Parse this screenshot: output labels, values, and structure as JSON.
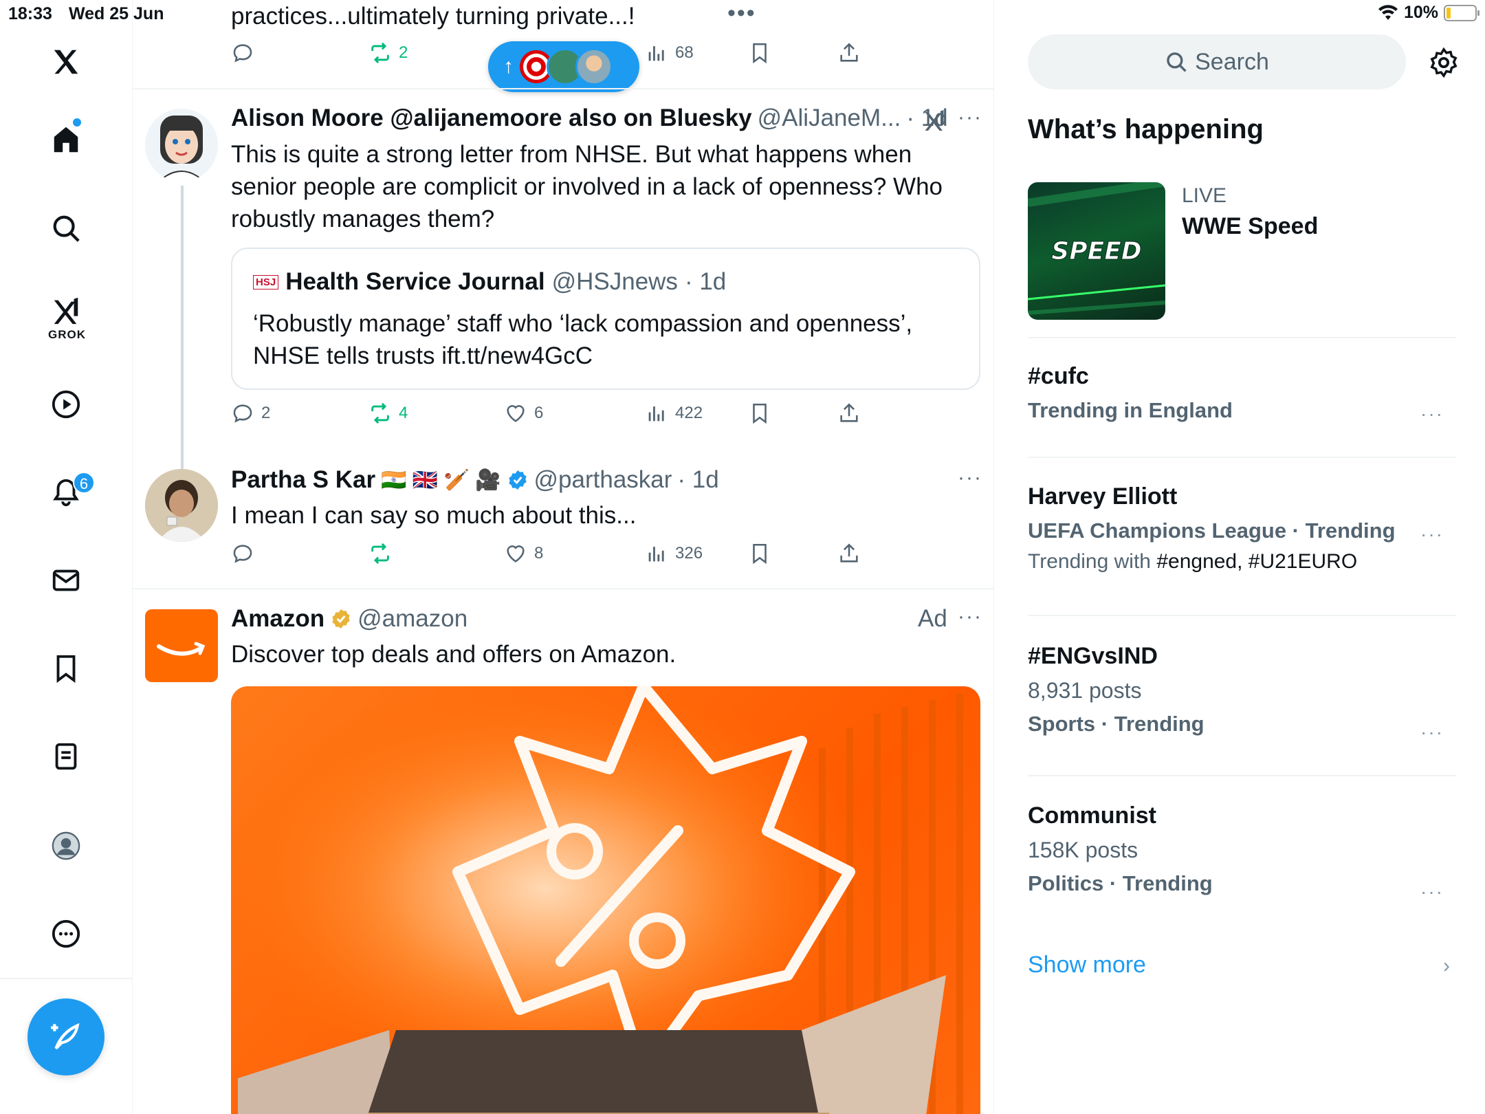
{
  "status": {
    "time": "18:33",
    "date": "Wed 25 Jun",
    "battery": "10%"
  },
  "nav": {
    "grok_label": "GROK",
    "notifications_count": "6"
  },
  "new_posts_pill": {
    "arrow": "↑"
  },
  "top_tweet": {
    "text": "practices...ultimately turning private...!",
    "retweets": "2",
    "views": "68"
  },
  "tweets": [
    {
      "name": "Alison Moore @alijanemoore also on Bluesky",
      "handle": "@AliJaneM...",
      "time": "· 1d",
      "text": "This is quite a strong letter from NHSE. But what happens when senior people are complicit or involved in a lack of openness? Who robustly manages them?",
      "quote": {
        "badge": "HSJ",
        "name": "Health Service Journal",
        "handle": "@HSJnews",
        "time": "· 1d",
        "text": "‘Robustly manage’ staff who ‘lack compassion and openness’, NHSE tells trusts ift.tt/new4GcC"
      },
      "replies": "2",
      "retweets": "4",
      "likes": "6",
      "views": "422"
    },
    {
      "name": "Partha S Kar",
      "emojis": "🇮🇳 🇬🇧 🏏 🎥",
      "handle": "@parthaskar",
      "time": "· 1d",
      "text": "I mean I can say so much about this...",
      "likes": "8",
      "views": "326"
    },
    {
      "name": "Amazon",
      "handle": "@amazon",
      "ad_label": "Ad",
      "text": "Discover top deals and offers on Amazon."
    }
  ],
  "right": {
    "search_placeholder": "Search",
    "heading": "What’s happening",
    "live": {
      "label": "LIVE",
      "title": "WWE Speed",
      "thumb_text": "SPEED"
    },
    "trends": [
      {
        "name": "#cufc",
        "meta": "Trending in England"
      },
      {
        "name": "Harvey Elliott",
        "meta": "UEFA Champions League · Trending",
        "with_prefix": "Trending with",
        "with_tags": "#engned, #U21EURO"
      },
      {
        "name": "#ENGvsIND",
        "posts": "8,931 posts",
        "meta": "Sports · Trending"
      },
      {
        "name": "Communist",
        "posts": "158K posts",
        "meta": "Politics · Trending"
      }
    ],
    "show_more": "Show more"
  },
  "colors": {
    "accent": "#1d9bf0",
    "retweet": "#00ba7c",
    "muted": "#536471",
    "amazon": "#ff6a00"
  },
  "icons": [
    "x-logo-icon",
    "home-icon",
    "search-icon",
    "grok-icon",
    "video-icon",
    "bell-icon",
    "mail-icon",
    "bookmark-icon",
    "list-icon",
    "profile-icon",
    "more-icon",
    "compose-icon",
    "reply-icon",
    "retweet-icon",
    "like-icon",
    "views-icon",
    "share-icon",
    "gear-icon",
    "chevron-right-icon"
  ]
}
